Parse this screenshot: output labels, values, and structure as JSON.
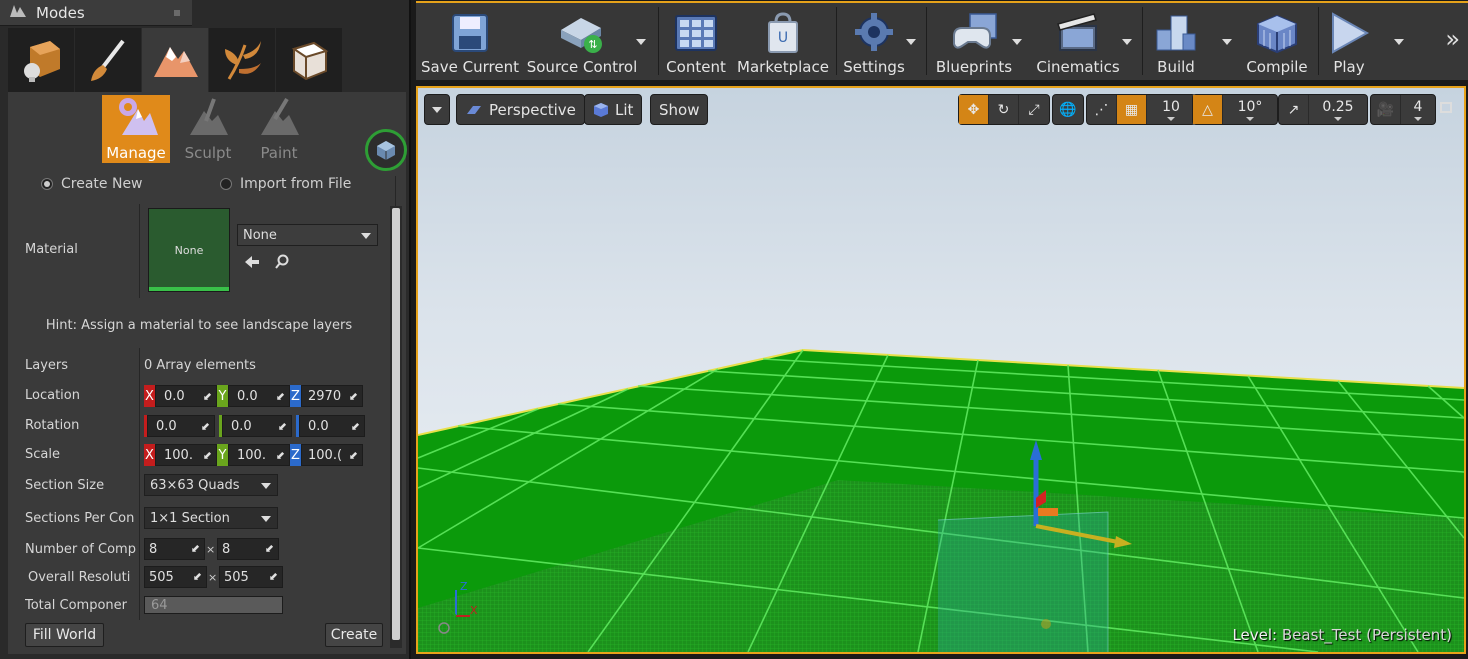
{
  "modes_panel": {
    "title": "Modes",
    "mode_tabs": [
      "place-mode",
      "paint-mode",
      "landscape-mode",
      "foliage-mode",
      "mesh-paint-mode"
    ],
    "tools": {
      "manage": "Manage",
      "sculpt": "Sculpt",
      "paint": "Paint"
    },
    "create_new": "Create New",
    "import_from_file": "Import from File",
    "material": {
      "label": "Material",
      "thumbnail": "None",
      "selected": "None"
    },
    "hint": "Hint: Assign a material to see landscape layers",
    "layers": {
      "label": "Layers",
      "value": "0 Array elements"
    },
    "location": {
      "label": "Location",
      "x": "0.0",
      "y": "0.0",
      "z": "2970"
    },
    "rotation": {
      "label": "Rotation",
      "x": "0.0",
      "y": "0.0",
      "z": "0.0"
    },
    "scale": {
      "label": "Scale",
      "x": "100.",
      "y": "100.",
      "z": "100.("
    },
    "section_size": {
      "label": "Section Size",
      "value": "63×63 Quads"
    },
    "sections_per_component": {
      "label": "Sections Per Con",
      "value": "1×1 Section"
    },
    "number_of_components": {
      "label": "Number of Comp",
      "x": "8",
      "y": "8"
    },
    "overall_resolution": {
      "label": "Overall Resoluti",
      "x": "505",
      "y": "505"
    },
    "total_components": {
      "label": "Total Componer",
      "value": "64"
    },
    "fill_world": "Fill World",
    "create": "Create"
  },
  "toolbar": {
    "save_current": "Save Current",
    "source_control": "Source Control",
    "content": "Content",
    "marketplace": "Marketplace",
    "settings": "Settings",
    "blueprints": "Blueprints",
    "cinematics": "Cinematics",
    "build": "Build",
    "compile": "Compile",
    "play": "Play"
  },
  "viewport": {
    "perspective": "Perspective",
    "lit": "Lit",
    "show": "Show",
    "grid_snap": "10",
    "rotation_snap": "10°",
    "scale_snap": "0.25",
    "camera_speed": "4",
    "level_prefix": "Level:",
    "level_name": "Beast_Test (Persistent)"
  },
  "colors": {
    "accent": "#e6a21a",
    "active_tool": "#e08a1a",
    "landscape_green": "#1f9a1f",
    "panel_bg": "#3a3a3a"
  }
}
